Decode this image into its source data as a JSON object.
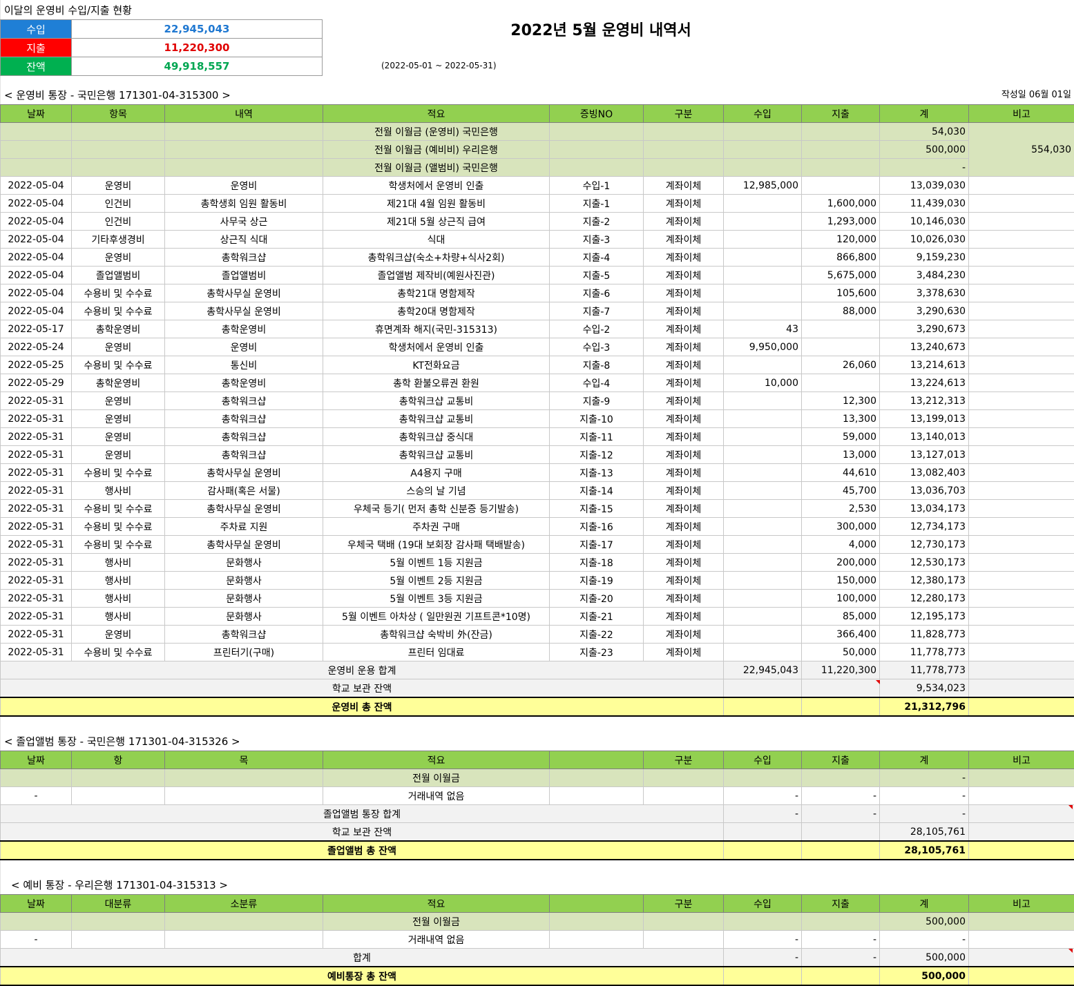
{
  "summary": {
    "title": "이달의 운영비 수입/지출 현황",
    "rows": [
      {
        "label": "수입",
        "value": "22,945,043",
        "label_bg": "#1f7fd6",
        "value_color": "#1f78d1"
      },
      {
        "label": "지출",
        "value": "11,220,300",
        "label_bg": "#ff0000",
        "value_color": "#e00000"
      },
      {
        "label": "잔액",
        "value": "49,918,557",
        "label_bg": "#00b050",
        "value_color": "#00a651"
      }
    ]
  },
  "header": {
    "title": "2022년 5월 운영비 내역서",
    "period": "(2022-05-01 ~ 2022-05-31)",
    "written_date": "작성일 06월 01일"
  },
  "operating": {
    "section_title": "< 운영비 통장 - 국민은행 171301-04-315300 >",
    "columns": [
      "날짜",
      "항목",
      "내역",
      "적요",
      "증빙NO",
      "구분",
      "수입",
      "지출",
      "계",
      "비고"
    ],
    "carry": [
      {
        "desc": "전월 이월금 (운영비) 국민은행",
        "balance": "54,030"
      },
      {
        "desc": "전월 이월금 (예비비) 우리은행",
        "balance": "500,000"
      },
      {
        "desc": "전월 이월금 (앨범비) 국민은행",
        "balance": "-"
      }
    ],
    "carry_note": "554,030",
    "rows": [
      [
        "2022-05-04",
        "운영비",
        "운영비",
        "학생처에서 운영비 인출",
        "수입-1",
        "계좌이체",
        "12,985,000",
        "",
        "13,039,030"
      ],
      [
        "2022-05-04",
        "인건비",
        "총학생회 임원 활동비",
        "제21대 4월 임원 활동비",
        "지출-1",
        "계좌이체",
        "",
        "1,600,000",
        "11,439,030"
      ],
      [
        "2022-05-04",
        "인건비",
        "사무국 상근",
        "제21대 5월 상근직 급여",
        "지출-2",
        "계좌이체",
        "",
        "1,293,000",
        "10,146,030"
      ],
      [
        "2022-05-04",
        "기타후생경비",
        "상근직 식대",
        "식대",
        "지출-3",
        "계좌이체",
        "",
        "120,000",
        "10,026,030"
      ],
      [
        "2022-05-04",
        "운영비",
        "총학워크샵",
        "총학워크샵(숙소+차량+식사2회)",
        "지출-4",
        "계좌이체",
        "",
        "866,800",
        "9,159,230"
      ],
      [
        "2022-05-04",
        "졸업앨범비",
        "졸업앨범비",
        "졸업앨범 제작비(예원사진관)",
        "지출-5",
        "계좌이체",
        "",
        "5,675,000",
        "3,484,230"
      ],
      [
        "2022-05-04",
        "수용비 및 수수료",
        "총학사무실 운영비",
        "총학21대 명함제작",
        "지출-6",
        "계좌이체",
        "",
        "105,600",
        "3,378,630"
      ],
      [
        "2022-05-04",
        "수용비 및 수수료",
        "총학사무실 운영비",
        "총학20대 명함제작",
        "지출-7",
        "계좌이체",
        "",
        "88,000",
        "3,290,630"
      ],
      [
        "2022-05-17",
        "총학운영비",
        "총학운영비",
        "휴면계좌 해지(국민-315313)",
        "수입-2",
        "계좌이체",
        "43",
        "",
        "3,290,673"
      ],
      [
        "2022-05-24",
        "운영비",
        "운영비",
        "학생처에서 운영비 인출",
        "수입-3",
        "계좌이체",
        "9,950,000",
        "",
        "13,240,673"
      ],
      [
        "2022-05-25",
        "수용비 및 수수료",
        "통신비",
        "KT전화요금",
        "지출-8",
        "계좌이체",
        "",
        "26,060",
        "13,214,613"
      ],
      [
        "2022-05-29",
        "총학운영비",
        "총학운영비",
        "총학 환불오류권 환원",
        "수입-4",
        "계좌이체",
        "10,000",
        "",
        "13,224,613"
      ],
      [
        "2022-05-31",
        "운영비",
        "총학워크샵",
        "총학워크샵 교통비",
        "지출-9",
        "계좌이체",
        "",
        "12,300",
        "13,212,313"
      ],
      [
        "2022-05-31",
        "운영비",
        "총학워크샵",
        "총학워크샵 교통비",
        "지출-10",
        "계좌이체",
        "",
        "13,300",
        "13,199,013"
      ],
      [
        "2022-05-31",
        "운영비",
        "총학워크샵",
        "총학워크샵 중식대",
        "지출-11",
        "계좌이체",
        "",
        "59,000",
        "13,140,013"
      ],
      [
        "2022-05-31",
        "운영비",
        "총학워크샵",
        "총학워크샵 교통비",
        "지출-12",
        "계좌이체",
        "",
        "13,000",
        "13,127,013"
      ],
      [
        "2022-05-31",
        "수용비 및 수수료",
        "총학사무실 운영비",
        "A4용지 구매",
        "지출-13",
        "계좌이체",
        "",
        "44,610",
        "13,082,403"
      ],
      [
        "2022-05-31",
        "행사비",
        "감사패(혹은 서물)",
        "스승의 날 기념",
        "지출-14",
        "계좌이체",
        "",
        "45,700",
        "13,036,703"
      ],
      [
        "2022-05-31",
        "수용비 및 수수료",
        "총학사무실 운영비",
        "우체국 등기( 먼저 총학 신분증 등기발송)",
        "지출-15",
        "계좌이체",
        "",
        "2,530",
        "13,034,173"
      ],
      [
        "2022-05-31",
        "수용비 및 수수료",
        "주차료 지원",
        "주차권 구매",
        "지출-16",
        "계좌이체",
        "",
        "300,000",
        "12,734,173"
      ],
      [
        "2022-05-31",
        "수용비 및 수수료",
        "총학사무실 운영비",
        "우체국 택배 (19대 보회장 감사패 택배발송)",
        "지출-17",
        "계좌이체",
        "",
        "4,000",
        "12,730,173"
      ],
      [
        "2022-05-31",
        "행사비",
        "문화행사",
        "5월 이벤트 1등 지원금",
        "지출-18",
        "계좌이체",
        "",
        "200,000",
        "12,530,173"
      ],
      [
        "2022-05-31",
        "행사비",
        "문화행사",
        "5월 이벤트 2등 지원금",
        "지출-19",
        "계좌이체",
        "",
        "150,000",
        "12,380,173"
      ],
      [
        "2022-05-31",
        "행사비",
        "문화행사",
        "5월 이벤트 3등 지원금",
        "지출-20",
        "계좌이체",
        "",
        "100,000",
        "12,280,173"
      ],
      [
        "2022-05-31",
        "행사비",
        "문화행사",
        "5월 이벤트 아차상 ( 일만원권 기프트콘*10명)",
        "지출-21",
        "계좌이체",
        "",
        "85,000",
        "12,195,173"
      ],
      [
        "2022-05-31",
        "운영비",
        "총학워크샵",
        "총학워크샵 숙박비 外(잔금)",
        "지출-22",
        "계좌이체",
        "",
        "366,400",
        "11,828,773"
      ],
      [
        "2022-05-31",
        "수용비 및 수수료",
        "프린터기(구매)",
        "프린터 임대료",
        "지출-23",
        "계좌이체",
        "",
        "50,000",
        "11,778,773"
      ]
    ],
    "subtotal": {
      "label": "운영비 운용 합계",
      "income": "22,945,043",
      "expense": "11,220,300",
      "balance": "11,778,773"
    },
    "school": {
      "label": "학교 보관 잔액",
      "balance": "9,534,023"
    },
    "total": {
      "label": "운영비 총 잔액",
      "balance": "21,312,796"
    }
  },
  "album": {
    "section_title": "< 졸업앨범 통장 - 국민은행 171301-04-315326 >",
    "columns": [
      "날짜",
      "항",
      "목",
      "적요",
      "",
      "구분",
      "수입",
      "지출",
      "계",
      "비고"
    ],
    "carry": {
      "desc": "전월 이월금",
      "balance": "-"
    },
    "row": {
      "date": "-",
      "desc": "거래내역 없음",
      "income": "-",
      "expense": "-",
      "balance": "-"
    },
    "subtotal": {
      "label": "졸업앨범 통장 합계",
      "income": "-",
      "expense": "-",
      "balance": "-"
    },
    "school": {
      "label": "학교 보관 잔액",
      "balance": "28,105,761"
    },
    "total": {
      "label": "졸업앨범 총 잔액",
      "balance": "28,105,761"
    }
  },
  "reserve": {
    "section_title": "< 예비 통장 - 우리은행 171301-04-315313 >",
    "columns": [
      "날짜",
      "대분류",
      "소분류",
      "적요",
      "",
      "구분",
      "수입",
      "지출",
      "계",
      "비고"
    ],
    "carry": {
      "desc": "전월 이월금",
      "balance": "500,000"
    },
    "row": {
      "date": "-",
      "desc": "거래내역 없음",
      "income": "-",
      "expense": "-",
      "balance": "-"
    },
    "subtotal": {
      "label": "합계",
      "income": "-",
      "expense": "-",
      "balance": "500,000"
    },
    "total": {
      "label": "예비통장 총 잔액",
      "balance": "500,000"
    }
  }
}
